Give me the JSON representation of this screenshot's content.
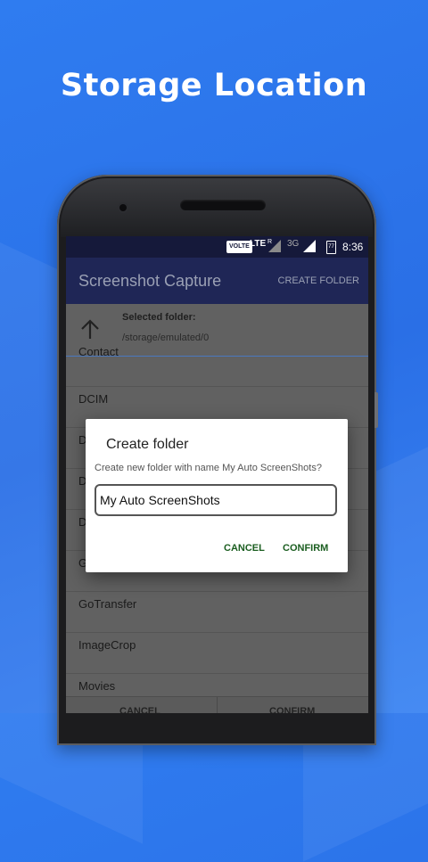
{
  "promo": {
    "title": "Storage Location"
  },
  "statusbar": {
    "volte": "VOLTE",
    "lte": "LTE",
    "roaming": "R",
    "network2": "3G",
    "battery": "77",
    "time": "8:36"
  },
  "appbar": {
    "title": "Screenshot Capture",
    "action": "CREATE FOLDER"
  },
  "folder_header": {
    "label": "Selected folder:",
    "path": "/storage/emulated/0"
  },
  "folders": [
    "Contact",
    "DCIM",
    "D",
    "D",
    "D",
    "G",
    "GoTransfer",
    "ImageCrop",
    "Movies"
  ],
  "bottom_bar": {
    "cancel": "CANCEL",
    "confirm": "CONFIRM"
  },
  "dialog": {
    "title": "Create folder",
    "message": "Create new folder with name My Auto ScreenShots?",
    "input_value": "My Auto ScreenShots",
    "cancel": "CANCEL",
    "confirm": "CONFIRM"
  },
  "colors": {
    "background": "#2f7cf0",
    "appbar": "#1f2656",
    "statusbar": "#15193a",
    "dialog_button": "#1b5e20"
  }
}
